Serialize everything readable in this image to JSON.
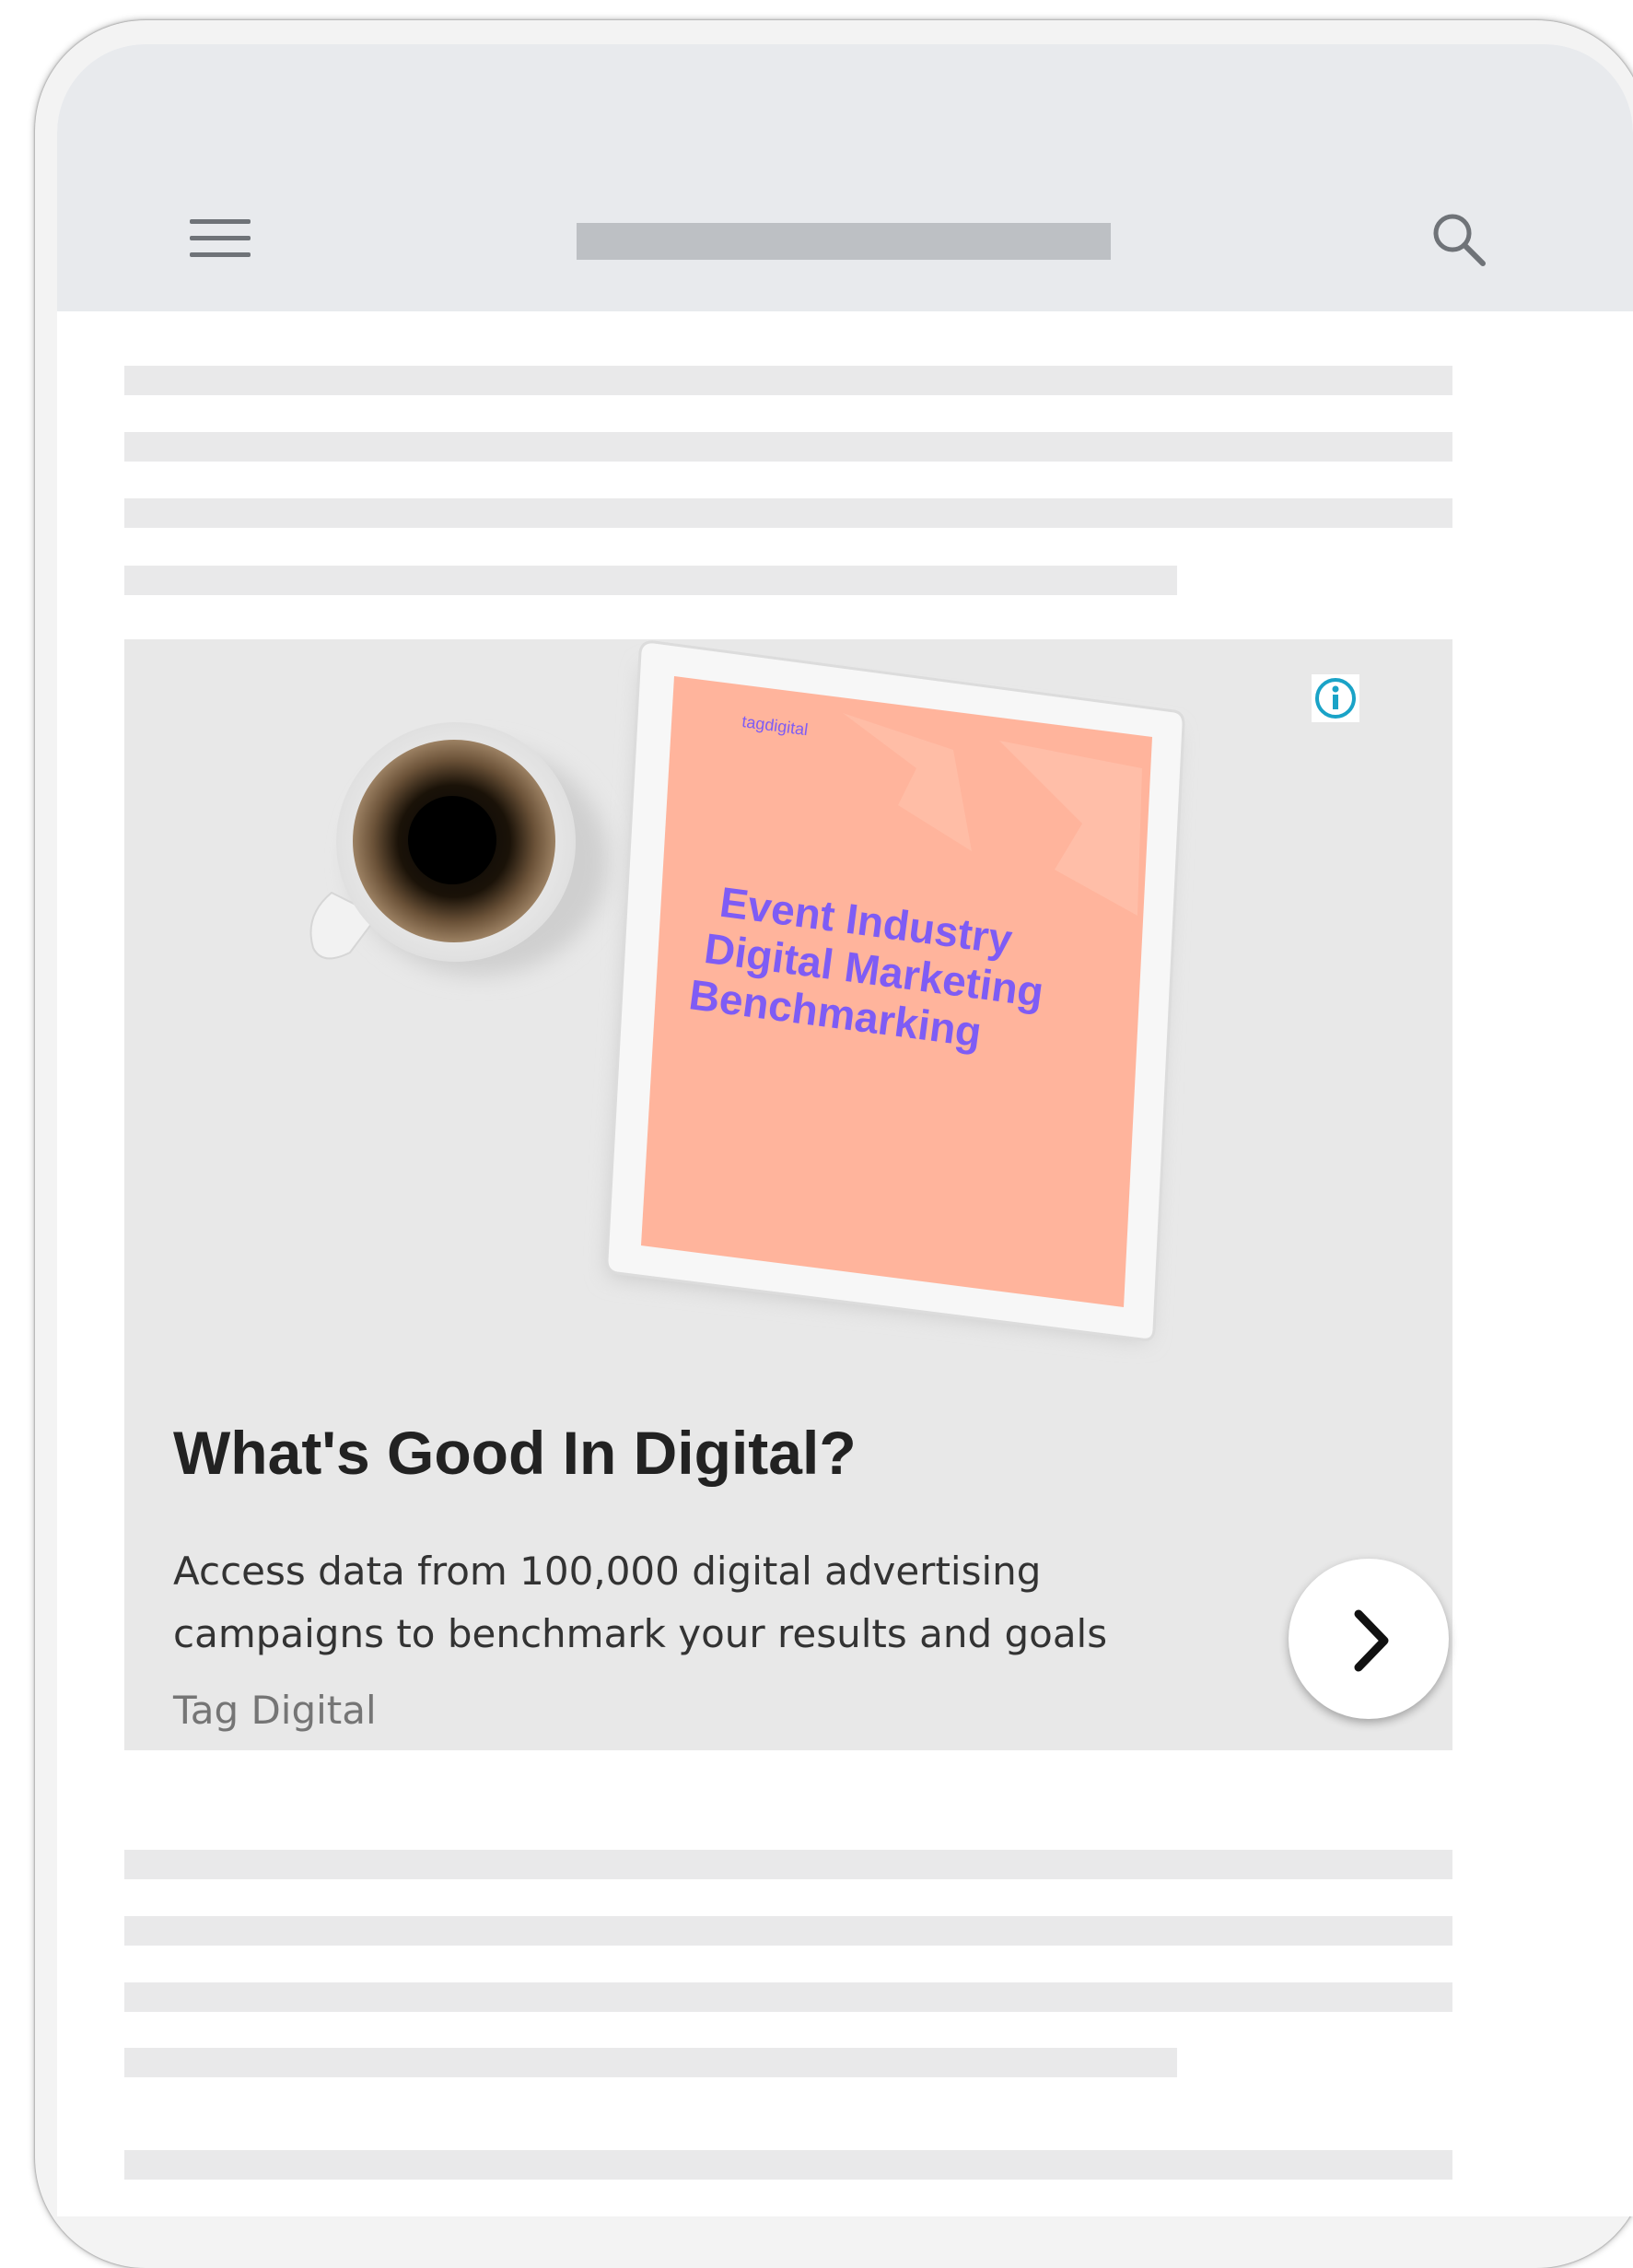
{
  "ad": {
    "headline": "What's Good In Digital?",
    "body": "Access data from 100,000 digital advertising campaigns to benchmark your results and goals",
    "advertiser": "Tag Digital",
    "image": {
      "brand": "tagdigital",
      "title_lines": [
        "Event Industry",
        "Digital Marketing",
        "Benchmarking"
      ]
    }
  },
  "icons": {
    "menu": "hamburger-menu-icon",
    "search": "search-icon",
    "info": "info-icon",
    "cta": "chevron-right-icon"
  },
  "colors": {
    "top_bar": "#e8eaed",
    "placeholder": "#e9e9ea",
    "ad_background": "#e8e8e8",
    "info_accent": "#1aa3c7",
    "tablet_screen": "#ffb49c",
    "tablet_text": "#7e5cf5"
  }
}
